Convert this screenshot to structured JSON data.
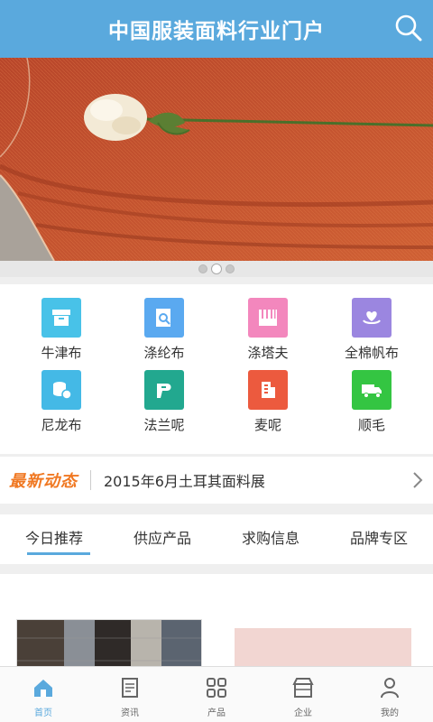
{
  "header": {
    "title": "中国服装面料行业门户"
  },
  "colors": {
    "brand": "#5aa9dd",
    "accent": "#f07822"
  },
  "banner": {
    "slides": 3,
    "active_index": 1
  },
  "categories": [
    {
      "label": "牛津布",
      "icon": "box-icon",
      "color": "#48c2e8"
    },
    {
      "label": "涤纶布",
      "icon": "search-doc-icon",
      "color": "#5aa9f0"
    },
    {
      "label": "涤塔夫",
      "icon": "piano-icon",
      "color": "#f387bd"
    },
    {
      "label": "全棉帆布",
      "icon": "heart-hand-icon",
      "color": "#9b86e0"
    },
    {
      "label": "尼龙布",
      "icon": "coins-icon",
      "color": "#44b9e6"
    },
    {
      "label": "法兰呢",
      "icon": "p-logo-icon",
      "color": "#22a88f"
    },
    {
      "label": "麦呢",
      "icon": "building-icon",
      "color": "#ec5a3e"
    },
    {
      "label": "顺毛",
      "icon": "truck-icon",
      "color": "#34c542"
    }
  ],
  "news": {
    "badge": "最新动态",
    "headline": "2015年6月土耳其面料展"
  },
  "tabs": [
    {
      "label": "今日推荐",
      "active": true
    },
    {
      "label": "供应产品",
      "active": false
    },
    {
      "label": "求购信息",
      "active": false
    },
    {
      "label": "品牌专区",
      "active": false
    }
  ],
  "bottom_nav": [
    {
      "label": "首页",
      "icon": "home-icon",
      "active": true
    },
    {
      "label": "资讯",
      "icon": "news-icon",
      "active": false
    },
    {
      "label": "产品",
      "icon": "grid-icon",
      "active": false
    },
    {
      "label": "企业",
      "icon": "store-icon",
      "active": false
    },
    {
      "label": "我的",
      "icon": "user-icon",
      "active": false
    }
  ]
}
